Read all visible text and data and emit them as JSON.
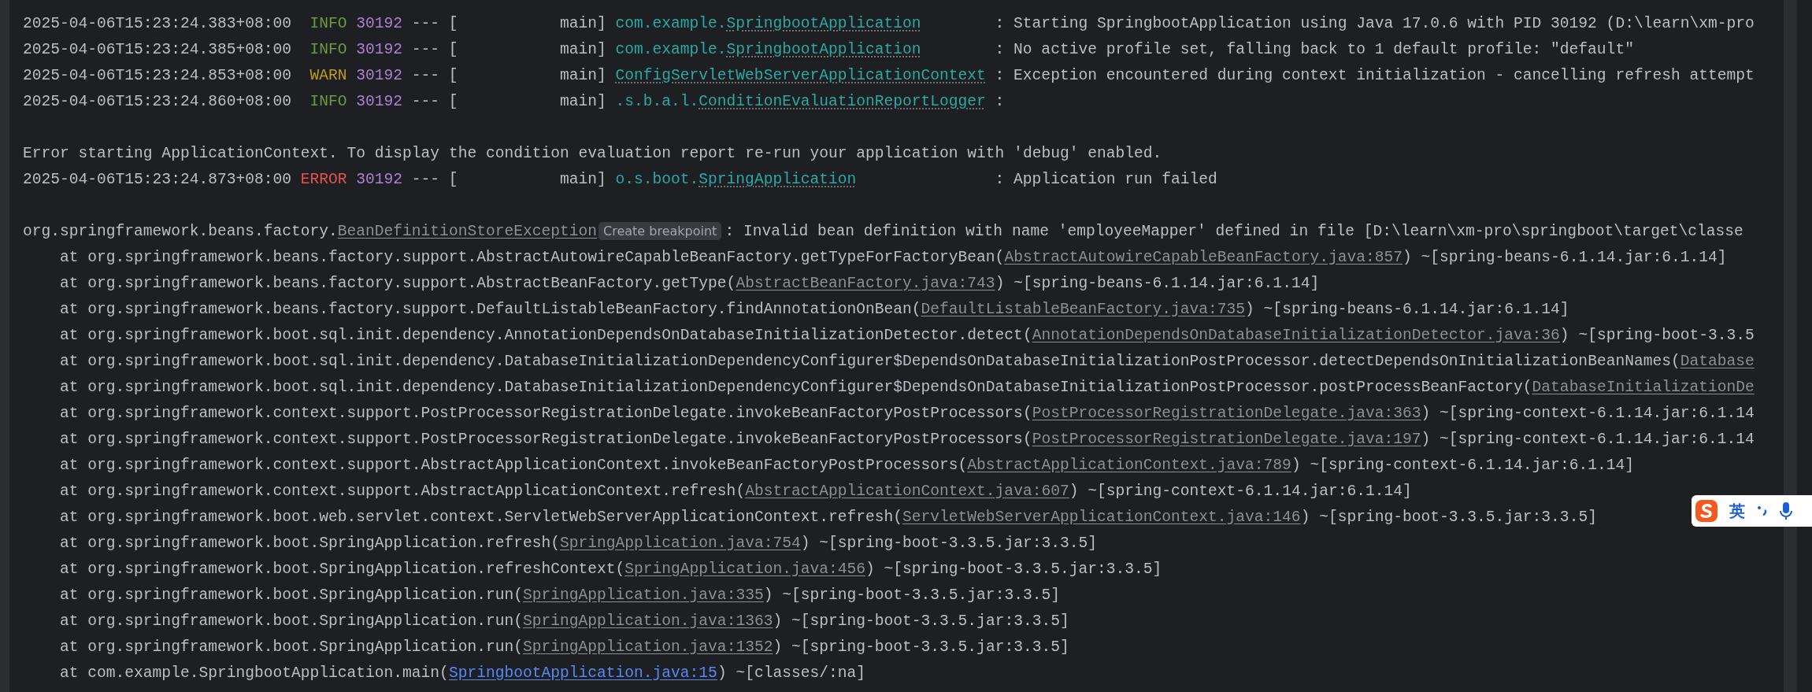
{
  "console": {
    "lines": [
      {
        "kind": "log",
        "timestamp": "2025-04-06T15:23:24.383+08:00",
        "level": {
          "text": "INFO",
          "color": "#6a9b3c"
        },
        "pid": "30192",
        "separator": "---",
        "thread": "[           main]",
        "logger_prefix": "com.example.",
        "logger_class": "SpringbootApplication",
        "message": ": Starting SpringbootApplication using Java 17.0.6 with PID 30192 (D:\\learn\\xm-pro"
      },
      {
        "kind": "log",
        "timestamp": "2025-04-06T15:23:24.385+08:00",
        "level": {
          "text": "INFO",
          "color": "#6a9b3c"
        },
        "pid": "30192",
        "separator": "---",
        "thread": "[           main]",
        "logger_prefix": "com.example.",
        "logger_class": "SpringbootApplication",
        "message": ": No active profile set, falling back to 1 default profile: \"default\""
      },
      {
        "kind": "log",
        "timestamp": "2025-04-06T15:23:24.853+08:00",
        "level": {
          "text": "WARN",
          "color": "#bf9a1c"
        },
        "pid": "30192",
        "separator": "---",
        "thread": "[           main]",
        "logger_class": "ConfigServletWebServerApplicationContext",
        "message": ": Exception encountered during context initialization - cancelling refresh attempt"
      },
      {
        "kind": "log",
        "timestamp": "2025-04-06T15:23:24.860+08:00",
        "level": {
          "text": "INFO",
          "color": "#6a9b3c"
        },
        "pid": "30192",
        "separator": "---",
        "thread": "[           main]",
        "logger_prefix": ".s.b.a.l.",
        "logger_class": "ConditionEvaluationReportLogger",
        "message": ":"
      },
      {
        "kind": "blank"
      },
      {
        "kind": "plain",
        "text": "Error starting ApplicationContext. To display the condition evaluation report re-run your application with 'debug' enabled."
      },
      {
        "kind": "log",
        "timestamp": "2025-04-06T15:23:24.873+08:00",
        "level": {
          "text": "ERROR",
          "color": "#e5534b"
        },
        "pid": "30192",
        "separator": "---",
        "thread": "[           main]",
        "logger_prefix": "o.s.boot.",
        "logger_class": "SpringApplication",
        "message": ": Application run failed"
      },
      {
        "kind": "blank"
      },
      {
        "kind": "exception",
        "prefix": "org.springframework.beans.factory.",
        "link": "BeanDefinitionStoreException",
        "hint": "Create breakpoint",
        "message": ": Invalid bean definition with name 'employeeMapper' defined in file [D:\\learn\\xm-pro\\springboot\\target\\classe"
      },
      {
        "kind": "frame",
        "text": "at org.springframework.beans.factory.support.AbstractAutowireCapableBeanFactory.getTypeForFactoryBean(",
        "link": "AbstractAutowireCapableBeanFactory.java:857",
        "suffix": ") ~[spring-beans-6.1.14.jar:6.1.14]",
        "in_project": false
      },
      {
        "kind": "frame",
        "text": "at org.springframework.beans.factory.support.AbstractBeanFactory.getType(",
        "link": "AbstractBeanFactory.java:743",
        "suffix": ") ~[spring-beans-6.1.14.jar:6.1.14]",
        "in_project": false
      },
      {
        "kind": "frame",
        "text": "at org.springframework.beans.factory.support.DefaultListableBeanFactory.findAnnotationOnBean(",
        "link": "DefaultListableBeanFactory.java:735",
        "suffix": ") ~[spring-beans-6.1.14.jar:6.1.14]",
        "in_project": false
      },
      {
        "kind": "frame",
        "text": "at org.springframework.boot.sql.init.dependency.AnnotationDependsOnDatabaseInitializationDetector.detect(",
        "link": "AnnotationDependsOnDatabaseInitializationDetector.java:36",
        "suffix": ") ~[spring-boot-3.3.5",
        "in_project": false
      },
      {
        "kind": "frame",
        "text": "at org.springframework.boot.sql.init.dependency.DatabaseInitializationDependencyConfigurer$DependsOnDatabaseInitializationPostProcessor.detectDependsOnInitializationBeanNames(",
        "link": "Database",
        "in_project": false
      },
      {
        "kind": "frame",
        "text": "at org.springframework.boot.sql.init.dependency.DatabaseInitializationDependencyConfigurer$DependsOnDatabaseInitializationPostProcessor.postProcessBeanFactory(",
        "link": "DatabaseInitializationDe",
        "in_project": false
      },
      {
        "kind": "frame",
        "text": "at org.springframework.context.support.PostProcessorRegistrationDelegate.invokeBeanFactoryPostProcessors(",
        "link": "PostProcessorRegistrationDelegate.java:363",
        "suffix": ") ~[spring-context-6.1.14.jar:6.1.14",
        "in_project": false
      },
      {
        "kind": "frame",
        "text": "at org.springframework.context.support.PostProcessorRegistrationDelegate.invokeBeanFactoryPostProcessors(",
        "link": "PostProcessorRegistrationDelegate.java:197",
        "suffix": ") ~[spring-context-6.1.14.jar:6.1.14",
        "in_project": false
      },
      {
        "kind": "frame",
        "text": "at org.springframework.context.support.AbstractApplicationContext.invokeBeanFactoryPostProcessors(",
        "link": "AbstractApplicationContext.java:789",
        "suffix": ") ~[spring-context-6.1.14.jar:6.1.14]",
        "in_project": false
      },
      {
        "kind": "frame",
        "text": "at org.springframework.context.support.AbstractApplicationContext.refresh(",
        "link": "AbstractApplicationContext.java:607",
        "suffix": ") ~[spring-context-6.1.14.jar:6.1.14]",
        "in_project": false
      },
      {
        "kind": "frame",
        "text": "at org.springframework.boot.web.servlet.context.ServletWebServerApplicationContext.refresh(",
        "link": "ServletWebServerApplicationContext.java:146",
        "suffix": ") ~[spring-boot-3.3.5.jar:3.3.5]",
        "in_project": false
      },
      {
        "kind": "frame",
        "text": "at org.springframework.boot.SpringApplication.refresh(",
        "link": "SpringApplication.java:754",
        "suffix": ") ~[spring-boot-3.3.5.jar:3.3.5]",
        "in_project": false
      },
      {
        "kind": "frame",
        "text": "at org.springframework.boot.SpringApplication.refreshContext(",
        "link": "SpringApplication.java:456",
        "suffix": ") ~[spring-boot-3.3.5.jar:3.3.5]",
        "in_project": false
      },
      {
        "kind": "frame",
        "text": "at org.springframework.boot.SpringApplication.run(",
        "link": "SpringApplication.java:335",
        "suffix": ") ~[spring-boot-3.3.5.jar:3.3.5]",
        "in_project": false
      },
      {
        "kind": "frame",
        "text": "at org.springframework.boot.SpringApplication.run(",
        "link": "SpringApplication.java:1363",
        "suffix": ") ~[spring-boot-3.3.5.jar:3.3.5]",
        "in_project": false
      },
      {
        "kind": "frame",
        "text": "at org.springframework.boot.SpringApplication.run(",
        "link": "SpringApplication.java:1352",
        "suffix": ") ~[spring-boot-3.3.5.jar:3.3.5]",
        "in_project": false
      },
      {
        "kind": "frame",
        "text": "at com.example.SpringbootApplication.main(",
        "link": "SpringbootApplication.java:15",
        "suffix": ") ~[classes/:na]",
        "in_project": true
      }
    ]
  },
  "ime_toolbar": {
    "mode": "英"
  }
}
